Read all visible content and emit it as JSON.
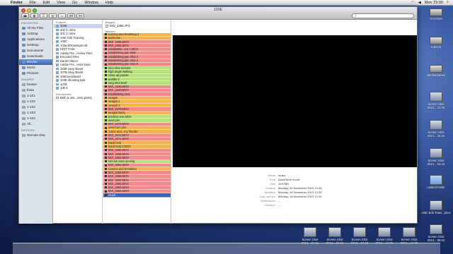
{
  "menubar": {
    "app": "Finder",
    "items": [
      "File",
      "Edit",
      "View",
      "Go",
      "Window",
      "Help"
    ],
    "clock": "Mon 15:00"
  },
  "window": {
    "title": "103E",
    "search_placeholder": ""
  },
  "sidebar": {
    "favorites_header": "FAVORITES",
    "favorites": [
      "All My Files",
      "AirDrop",
      "Applications",
      "Desktop",
      "Documents",
      "Downloads",
      "Movies",
      "Music",
      "Pictures"
    ],
    "selected": "Movies",
    "shared_header": "SHARED",
    "shared": [
      "beaker",
      "theia",
      "1-101",
      "1-103",
      "1-102",
      "1-103",
      "1-104",
      "All..."
    ],
    "devices_header": "DEVICES",
    "devices": [
      "Remote Disc"
    ]
  },
  "column1": {
    "folders_header": "Folders",
    "folders": [
      "103E",
      "202 3 crime",
      "201 3 crime",
      "106c Edit Training",
      "106C",
      "103editTrainingScott",
      "EDIT TASK",
      "Adobe Pre...review Files",
      "Encoded Files",
      "Daniel Sheen",
      "Adobe Pre...Auto-Save",
      "103E Sexy Beast",
      "107B Sexy Beast",
      "106Csexybeast",
      "103E shooting task",
      "107B",
      "106 C"
    ],
    "documents_header": "Documents",
    "documents": [
      "Beth & Joe...cess.prproj"
    ]
  },
  "column2": {
    "images_header": "Images",
    "images": [
      "IMG_1468.JPG"
    ],
    "movies_header": "Movies",
    "movies": [
      {
        "name": "running and breathing 2",
        "color": "#f6b24c"
      },
      {
        "name": "bathroom",
        "color": "#f6b24c"
      },
      {
        "name": "MVI_3485.MOV",
        "color": "#f58a8a"
      },
      {
        "name": "MVI_3491.MOV",
        "color": "#f58a8a"
      },
      {
        "name": "establishin...hot 1 MOV",
        "color": "#f58a8a"
      },
      {
        "name": "establishing pan shot",
        "color": "#f58a8a"
      },
      {
        "name": "establishing pan shot 2",
        "color": "#f58a8a"
      },
      {
        "name": "establishing pan shot 4",
        "color": "#f58a8a"
      },
      {
        "name": "establishing pan shot 5",
        "color": "#f58a8a"
      },
      {
        "name": "long shot running",
        "color": "#b6e079"
      },
      {
        "name": "high angle walking",
        "color": "#b6e079"
      },
      {
        "name": "close up puddle",
        "color": "#b6e079"
      },
      {
        "name": "puddle 2",
        "color": "#b6e079"
      },
      {
        "name": "long shot level",
        "color": "#b6e079"
      },
      {
        "name": "MVI_3446.MOV",
        "color": "#f58a8a"
      },
      {
        "name": "MVI_3449.MOV",
        "color": "#f58a8a"
      },
      {
        "name": "establishing shot",
        "color": "#f58a8a"
      },
      {
        "name": "seagull",
        "color": "#f6b24c"
      },
      {
        "name": "seagull 2",
        "color": "#f6b24c"
      },
      {
        "name": "seagull 3",
        "color": "#f6b24c"
      },
      {
        "name": "MVI_3479.MOV",
        "color": "#f58a8a"
      },
      {
        "name": "seagull flying",
        "color": "#f6b24c"
      },
      {
        "name": "brighton eye.MOV",
        "color": "#b6e079"
      },
      {
        "name": "west pier",
        "color": "#b6e079"
      },
      {
        "name": "MVI_3475.MOV",
        "color": "#f58a8a"
      },
      {
        "name": "view from pier",
        "color": "#f6b24c"
      },
      {
        "name": "'come and...my friends'",
        "color": "#f6b24c"
      },
      {
        "name": "MVI_3472.MOV",
        "color": "#f58a8a"
      },
      {
        "name": "MVI_3471.MOV",
        "color": "#f58a8a"
      },
      {
        "name": "hand held",
        "color": "#f6b24c"
      },
      {
        "name": "hand held 2.MOV",
        "color": "#f6b24c"
      },
      {
        "name": "MVI_3466.MOV",
        "color": "#f58a8a"
      },
      {
        "name": "MVI_3465.MOV",
        "color": "#f58a8a"
      },
      {
        "name": "MVI_3464.MOV",
        "color": "#f58a8a"
      },
      {
        "name": "lots fun area running",
        "color": "#b6e079"
      },
      {
        "name": "MVI_3461.MOV",
        "color": "#f58a8a"
      },
      {
        "name": "running and breathing",
        "color": "#f6b24c"
      },
      {
        "name": "MVI_3459.MOV",
        "color": "#f58a8a"
      },
      {
        "name": "MVI_3458.MOV",
        "color": "#f58a8a"
      },
      {
        "name": "MVI_3457.MOV",
        "color": "#f58a8a"
      },
      {
        "name": "MVI_3456.MOV",
        "color": "#f58a8a"
      },
      {
        "name": "MVI_3455.MOV",
        "color": "#f58a8a"
      },
      {
        "name": "MVI_3454.MOV",
        "color": "#f58a8a"
      },
      {
        "name": "music",
        "color": "#3b65b3",
        "selected": true
      }
    ]
  },
  "preview": {
    "info": [
      {
        "label": "Name",
        "value": "music"
      },
      {
        "label": "Kind",
        "value": "QuickTime movie"
      },
      {
        "label": "Size",
        "value": "19.5 MB"
      },
      {
        "label": "Created",
        "value": "Monday, 18 November 2013 13:34"
      },
      {
        "label": "Modified",
        "value": "Monday, 18 November 2013 13:34"
      },
      {
        "label": "Last opened",
        "value": "Monday, 18 November 2013 13:34"
      },
      {
        "label": "Dimensions",
        "value": "--"
      },
      {
        "label": "Duration",
        "value": "--"
      }
    ]
  },
  "desktop": {
    "icons": [
      {
        "label": "SYSTEM",
        "type": "disk"
      },
      {
        "label": "Kubrick",
        "type": "disk"
      },
      {
        "label": "MediaShared",
        "type": "disk"
      },
      {
        "label": "Screen Shot 2013....12.06",
        "type": "shot"
      },
      {
        "label": "Screen Shot 2013....15.32",
        "type": "shot"
      },
      {
        "label": "Screen Shot 2013....16.44",
        "type": "shot"
      },
      {
        "label": "untitled folder",
        "type": "folder"
      },
      {
        "label": "106c Edit Traini...jmov",
        "type": "shot"
      },
      {
        "label": "Screen Shot 2013....08.04",
        "type": "shot"
      }
    ],
    "bottom_icons": [
      "Screen Shot 2013....24.11",
      "Screen Shot 2013....26.51",
      "Screen Shot 2013....34.52",
      "Screen Shot 2013....17.05",
      "Screen Shot 2013....17.08"
    ]
  }
}
